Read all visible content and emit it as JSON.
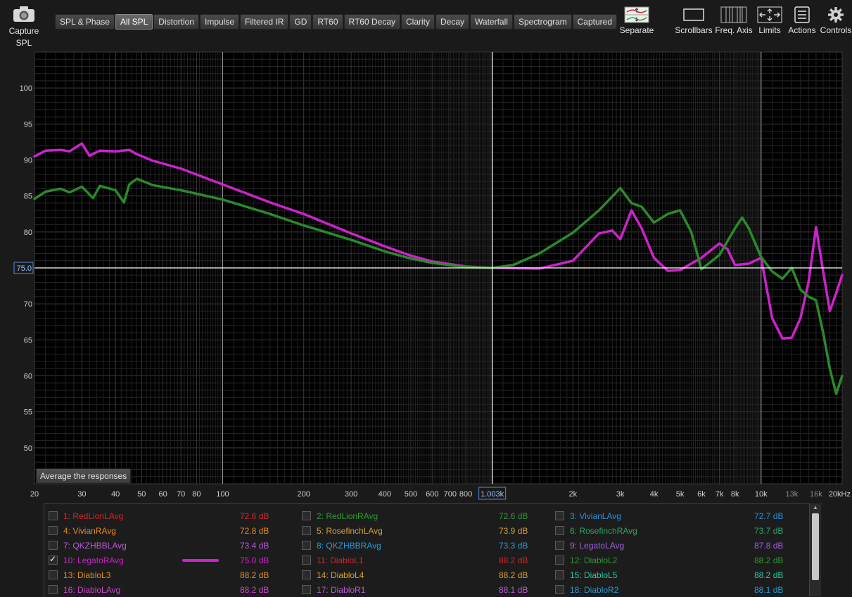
{
  "toolbar": {
    "capture_label": "Capture",
    "capture_sub": "SPL",
    "tabs": [
      {
        "label": "SPL & Phase",
        "active": false
      },
      {
        "label": "All SPL",
        "active": true
      },
      {
        "label": "Distortion",
        "active": false
      },
      {
        "label": "Impulse",
        "active": false
      },
      {
        "label": "Filtered IR",
        "active": false
      },
      {
        "label": "GD",
        "active": false
      },
      {
        "label": "RT60",
        "active": false
      },
      {
        "label": "RT60 Decay",
        "active": false
      },
      {
        "label": "Clarity",
        "active": false
      },
      {
        "label": "Decay",
        "active": false
      },
      {
        "label": "Waterfall",
        "active": false
      },
      {
        "label": "Spectrogram",
        "active": false
      },
      {
        "label": "Captured",
        "active": false
      }
    ],
    "tools": [
      {
        "label": "Separate",
        "icon": "separate-icon"
      },
      {
        "label": "Scrollbars",
        "icon": "scrollbars-icon"
      },
      {
        "label": "Freq. Axis",
        "icon": "freq-axis-icon"
      },
      {
        "label": "Limits",
        "icon": "limits-icon"
      },
      {
        "label": "Actions",
        "icon": "actions-icon"
      },
      {
        "label": "Controls",
        "icon": "gear-icon"
      }
    ]
  },
  "graph": {
    "y_ticks": [
      "100",
      "95",
      "90",
      "85",
      "80",
      "75.0",
      "70",
      "65",
      "60",
      "55",
      "50"
    ],
    "x_ticks": [
      "20",
      "30",
      "40",
      "50",
      "60",
      "70",
      "80",
      "100",
      "200",
      "300",
      "400",
      "500",
      "600",
      "700",
      "800",
      "1.003k",
      "2k",
      "3k",
      "4k",
      "5k",
      "6k",
      "7k",
      "8k",
      "10k",
      "13k",
      "16k",
      "20kHz"
    ],
    "cursor_x_label": "1.003k",
    "cursor_y_label": "75.0",
    "average_button": "Average the responses",
    "colors": {
      "background": "#000000",
      "grid": "#2e2e2e",
      "green": "#2a8a2a",
      "magenta": "#cc22cc",
      "cursor": "#ffffff"
    }
  },
  "chart_data": {
    "type": "line",
    "x_scale": "log",
    "xlim": [
      20,
      20000
    ],
    "ylim": [
      45,
      105
    ],
    "xlabel": "",
    "ylabel": "",
    "series": [
      {
        "name": "LegatoRAvg",
        "color": "#cc22cc",
        "x": [
          20,
          22,
          25,
          27,
          30,
          32,
          35,
          40,
          45,
          48,
          55,
          70,
          100,
          150,
          200,
          300,
          400,
          500,
          600,
          800,
          1003,
          1500,
          2000,
          2500,
          2800,
          3000,
          3300,
          3600,
          4000,
          4500,
          5000,
          6000,
          7000,
          7500,
          8000,
          9000,
          10000,
          11000,
          12000,
          13000,
          14000,
          15000,
          16000,
          17000,
          18000,
          19000,
          20000
        ],
        "y": [
          90.5,
          91.3,
          91.4,
          91.2,
          92.3,
          90.6,
          91.3,
          91.2,
          91.4,
          90.8,
          89.9,
          88.8,
          86.6,
          84.1,
          82.5,
          79.8,
          78.0,
          76.7,
          75.9,
          75.2,
          75.0,
          74.9,
          76.0,
          79.8,
          80.2,
          79.0,
          83.0,
          80.5,
          76.4,
          74.6,
          74.7,
          76.4,
          78.4,
          77.6,
          75.4,
          75.6,
          76.4,
          68.0,
          65.2,
          65.3,
          68.0,
          73.0,
          80.7,
          74.5,
          69.0,
          71.5,
          74.0
        ]
      },
      {
        "name": "RedLionRAvg",
        "color": "#2a8a2a",
        "x": [
          20,
          22,
          25,
          27,
          30,
          33,
          35,
          40,
          43,
          45,
          48,
          55,
          70,
          100,
          150,
          200,
          300,
          400,
          500,
          600,
          800,
          1003,
          1200,
          1500,
          2000,
          2500,
          3000,
          3300,
          3600,
          4000,
          4500,
          5000,
          5500,
          6000,
          7000,
          8000,
          8500,
          9000,
          10000,
          11000,
          12000,
          13000,
          14000,
          15000,
          16000,
          17000,
          18000,
          19000,
          20000
        ],
        "y": [
          84.6,
          85.6,
          86.0,
          85.5,
          86.3,
          84.7,
          86.4,
          85.8,
          84.1,
          86.6,
          87.4,
          86.5,
          85.8,
          84.5,
          82.5,
          80.9,
          78.9,
          77.3,
          76.3,
          75.7,
          75.1,
          75.0,
          75.4,
          77.0,
          79.9,
          83.0,
          86.1,
          84.0,
          83.5,
          81.3,
          82.5,
          83.0,
          80.0,
          74.8,
          76.8,
          80.5,
          82.0,
          80.5,
          76.5,
          74.5,
          73.5,
          75.0,
          72.0,
          71.0,
          70.5,
          66.0,
          61.0,
          57.5,
          60.0
        ]
      }
    ]
  },
  "legend": {
    "items": [
      {
        "label": "1: RedLionLAvg",
        "value": "72.6 dB",
        "color": "#d02828",
        "checked": false
      },
      {
        "label": "2: RedLionRAvg",
        "value": "72.6 dB",
        "color": "#2e9a2e",
        "checked": false
      },
      {
        "label": "3: VivianLAvg",
        "value": "72.7 dB",
        "color": "#2a8fd6",
        "checked": false
      },
      {
        "label": "4: VivianRAvg",
        "value": "72.8 dB",
        "color": "#e08a22",
        "checked": false
      },
      {
        "label": "5: RosefinchLAvg",
        "value": "73.9 dB",
        "color": "#d6a030",
        "checked": false
      },
      {
        "label": "6: RosefinchRAvg",
        "value": "73.7 dB",
        "color": "#2aa86a",
        "checked": false
      },
      {
        "label": "7: QKZHBBLAvg",
        "value": "73.4 dB",
        "color": "#b85ad6",
        "checked": false
      },
      {
        "label": "8: QKZHBBRAvg",
        "value": "73.3 dB",
        "color": "#2a9ad6",
        "checked": false
      },
      {
        "label": "9: LegatoLAvg",
        "value": "87.8 dB",
        "color": "#a060e0",
        "checked": false
      },
      {
        "label": "10: LegatoRAvg",
        "value": "75.0 dB",
        "color": "#cc22cc",
        "checked": true
      },
      {
        "label": "11: DiabloL1",
        "value": "88.2 dB",
        "color": "#d02828",
        "checked": false
      },
      {
        "label": "12: DiabloL2",
        "value": "88.2 dB",
        "color": "#2e9a2e",
        "checked": false
      },
      {
        "label": "13: DiabloL3",
        "value": "88.2 dB",
        "color": "#e08a22",
        "checked": false
      },
      {
        "label": "14: DiabloL4",
        "value": "88.2 dB",
        "color": "#d6a030",
        "checked": false
      },
      {
        "label": "15: DiabloL5",
        "value": "88.2 dB",
        "color": "#2ac8a0",
        "checked": false
      },
      {
        "label": "16: DiabloLAvg",
        "value": "88.2 dB",
        "color": "#cc44cc",
        "checked": false
      },
      {
        "label": "17: DiabloR1",
        "value": "88.1 dB",
        "color": "#b85ad6",
        "checked": false
      },
      {
        "label": "18: DiabloR2",
        "value": "88.1 dB",
        "color": "#2a9ad6",
        "checked": false
      }
    ]
  }
}
